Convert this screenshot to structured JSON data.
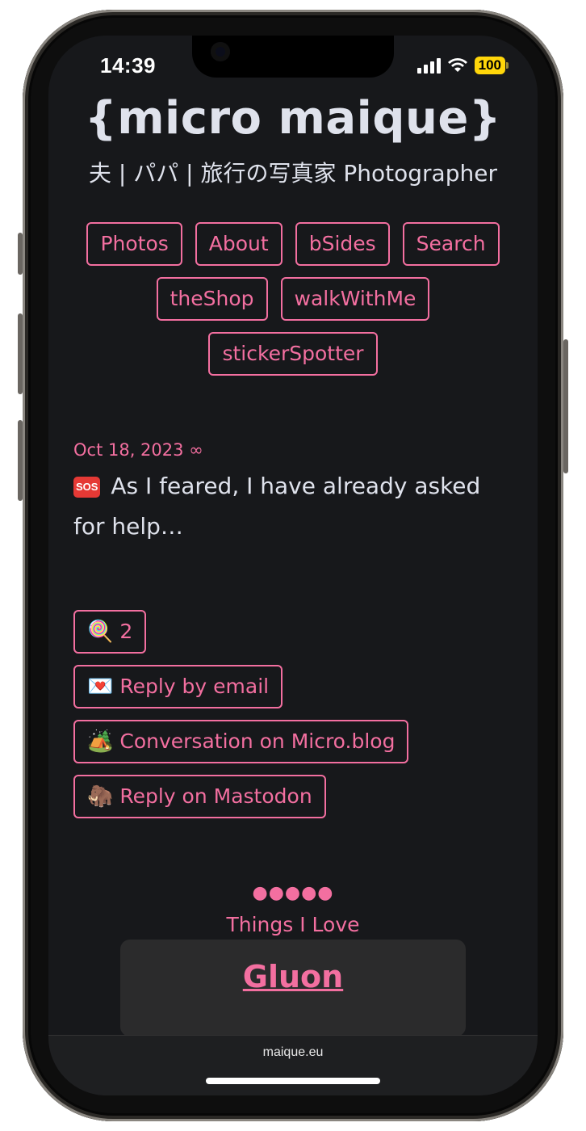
{
  "status_bar": {
    "time": "14:39",
    "battery": "100",
    "icons": [
      "cellular-signal-icon",
      "wifi-icon",
      "battery-icon"
    ]
  },
  "site": {
    "title": "{micro maique}",
    "subtitle": "夫 | パパ | 旅行の写真家 Photographer"
  },
  "nav": {
    "items": [
      "Photos",
      "About",
      "bSides",
      "Search",
      "theShop",
      "walkWithMe",
      "stickerSpotter"
    ]
  },
  "post": {
    "date": "Oct 18, 2023 ∞",
    "sos_icon": "🆘",
    "body": "As I feared, I have already asked for help…",
    "actions": [
      {
        "emoji": "🍭",
        "label": "2"
      },
      {
        "emoji": "💌",
        "label": "Reply by email"
      },
      {
        "emoji": "🏕️",
        "label": "Conversation on Micro.blog"
      },
      {
        "emoji": "🦣",
        "label": "Reply on Mastodon"
      }
    ]
  },
  "footer": {
    "dots": "●●●●●",
    "things_title": "Things I Love",
    "featured_link": "Gluon"
  },
  "browser": {
    "url": "maique.eu"
  },
  "colors": {
    "accent": "#f36fa0",
    "background": "#17181b",
    "text": "#dfe2ec",
    "card": "#2b2b2c"
  }
}
